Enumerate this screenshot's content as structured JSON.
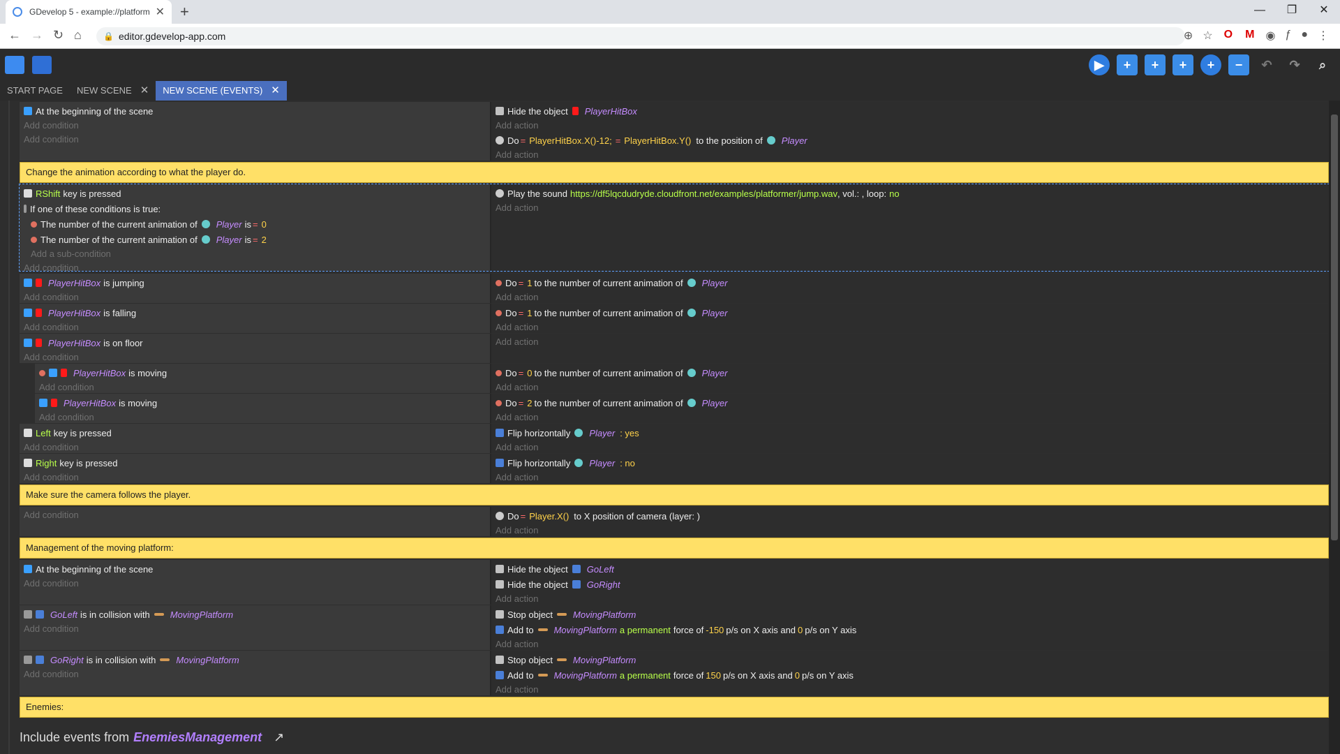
{
  "browser": {
    "tab_title": "GDevelop 5 - example://platform",
    "url": "editor.gdevelop-app.com"
  },
  "editor_tabs": [
    {
      "label": "START PAGE"
    },
    {
      "label": "NEW SCENE"
    },
    {
      "label": "NEW SCENE (EVENTS)"
    }
  ],
  "labels": {
    "add_condition": "Add condition",
    "add_action": "Add action",
    "add_sub_condition": "Add a sub-condition"
  },
  "events": {
    "e1": {
      "cond1": "At the beginning of the scene",
      "act1_pre": "Hide the object",
      "act1_obj": "PlayerHitBox",
      "act2_pre": "Do",
      "act2_x": "PlayerHitBox.X()-12;",
      "act2_y": "PlayerHitBox.Y()",
      "act2_mid": "to the position of",
      "act2_obj": "Player"
    },
    "comment1": "Change the animation according to what the player do.",
    "e2": {
      "key": "RShift",
      "key_suffix": "key is pressed",
      "or_text": "If one of these conditions is true:",
      "sub1_pre": "The number of the current animation of",
      "sub1_obj": "Player",
      "sub1_is": "is",
      "sub1_val": "0",
      "sub2_pre": "The number of the current animation of",
      "sub2_obj": "Player",
      "sub2_is": "is",
      "sub2_val": "2",
      "act_pre": "Play the sound",
      "act_url": "https://df5lqcdudryde.cloudfront.net/examples/platformer/jump.wav",
      "act_mid": ", vol.: , loop:",
      "act_loop": "no"
    },
    "e3": {
      "obj": "PlayerHitBox",
      "state": "is jumping",
      "act_pre": "Do",
      "act_val": "1",
      "act_mid": "to the number of current animation of",
      "act_obj": "Player"
    },
    "e4": {
      "obj": "PlayerHitBox",
      "state": "is falling",
      "act_pre": "Do",
      "act_val": "1",
      "act_mid": "to the number of current animation of",
      "act_obj": "Player"
    },
    "e5": {
      "obj": "PlayerHitBox",
      "state": "is on floor"
    },
    "e5a": {
      "obj": "PlayerHitBox",
      "state": "is moving",
      "act_pre": "Do",
      "act_val": "0",
      "act_mid": "to the number of current animation of",
      "act_obj": "Player"
    },
    "e5b": {
      "obj": "PlayerHitBox",
      "state": "is moving",
      "act_pre": "Do",
      "act_val": "2",
      "act_mid": "to the number of current animation of",
      "act_obj": "Player"
    },
    "e6": {
      "key": "Left",
      "key_suffix": "key is pressed",
      "act_pre": "Flip horizontally",
      "act_obj": "Player",
      "act_val": ": yes"
    },
    "e7": {
      "key": "Right",
      "key_suffix": "key is pressed",
      "act_pre": "Flip horizontally",
      "act_obj": "Player",
      "act_val": ": no"
    },
    "comment2": "Make sure the camera follows the player.",
    "e8": {
      "act_pre": "Do",
      "act_expr": "Player.X()",
      "act_mid": "to X position of camera  (layer: )"
    },
    "comment3": "Management of the moving platform:",
    "e9": {
      "cond1": "At the beginning of the scene",
      "act1_pre": "Hide the object",
      "act1_obj": "GoLeft",
      "act2_pre": "Hide the object",
      "act2_obj": "GoRight"
    },
    "e10": {
      "obj": "GoLeft",
      "mid": "is in collision with",
      "obj2": "MovingPlatform",
      "act1_pre": "Stop object",
      "act1_obj": "MovingPlatform",
      "act2_pre": "Add to",
      "act2_obj": "MovingPlatform",
      "act2_perm": "a permanent",
      "act2_force": "force of",
      "act2_x": "-150",
      "act2_xs": "p/s on X axis and",
      "act2_y": "0",
      "act2_ys": "p/s on Y axis"
    },
    "e11": {
      "obj": "GoRight",
      "mid": "is in collision with",
      "obj2": "MovingPlatform",
      "act1_pre": "Stop object",
      "act1_obj": "MovingPlatform",
      "act2_pre": "Add to",
      "act2_obj": "MovingPlatform",
      "act2_perm": "a permanent",
      "act2_force": "force of",
      "act2_x": "150",
      "act2_xs": "p/s on X axis and",
      "act2_y": "0",
      "act2_ys": "p/s on Y axis"
    },
    "comment4": "Enemies:",
    "include_pre": "Include events from",
    "include_name": "EnemiesManagement"
  }
}
